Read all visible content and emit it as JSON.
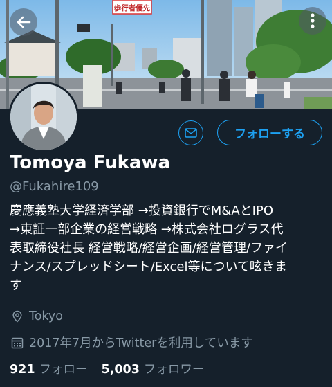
{
  "banner": {
    "sign_text": "歩行者優先"
  },
  "profile": {
    "name": "Tomoya Fukawa",
    "handle": "@Fukahire109",
    "bio_lines": [
      "慶應義塾大学経済学部 →投資銀行でM&AとIPO",
      "→東証一部企業の経営戦略 →株式会社ログラス代",
      "表取締役社長  経営戦略/経営企画/経営管理/ファイ",
      "ナンス/スプレッドシート/Excel等について呟きま",
      "す"
    ],
    "location": "Tokyo",
    "joined": "2017年7月からTwitterを利用しています"
  },
  "actions": {
    "follow_label": "フォローする"
  },
  "stats": {
    "following_count": "921",
    "following_label": "フォロー",
    "followers_count": "5,003",
    "followers_label": "フォロワー"
  },
  "icons": {
    "back": "arrow-left-icon",
    "more": "vertical-dots-icon",
    "mail": "envelope-icon",
    "location": "map-pin-icon",
    "calendar": "calendar-icon"
  },
  "colors": {
    "background": "#15202b",
    "accent": "#1da1f2",
    "secondary_text": "#8899a6"
  }
}
